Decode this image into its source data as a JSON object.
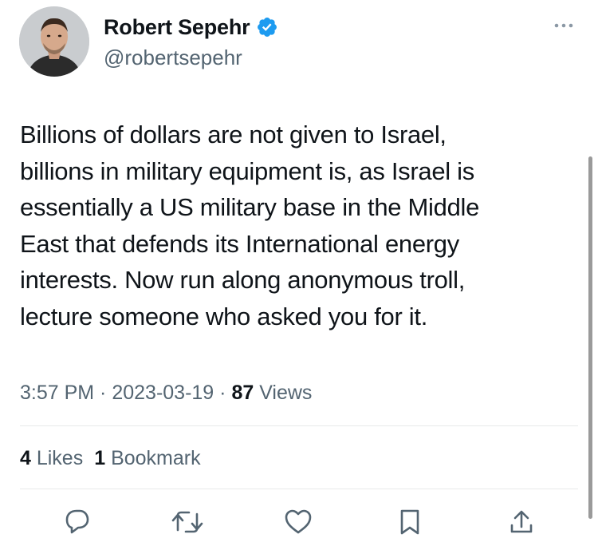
{
  "author": {
    "display_name": "Robert Sepehr",
    "handle": "@robertsepehr",
    "verified": true
  },
  "tweet": {
    "text": "Billions of dollars are not given to Israel,\nbillions in military equipment is, as Israel is\nessentially a US military base in the Middle\nEast that defends its International energy\ninterests. Now run along anonymous troll,\nlecture someone who asked you for it."
  },
  "meta": {
    "time": "3:57 PM",
    "separator": " · ",
    "date": "2023-03-19",
    "views_count": "87",
    "views_label": " Views"
  },
  "stats": {
    "likes_count": "4",
    "likes_label": " Likes",
    "bookmarks_count": "1",
    "bookmarks_label": " Bookmark"
  },
  "icons": {
    "more": "more-icon",
    "verified": "verified-badge-icon",
    "reply": "reply-icon",
    "retweet": "retweet-icon",
    "like": "like-icon",
    "bookmark": "bookmark-icon",
    "share": "share-icon"
  },
  "colors": {
    "verified_blue": "#1d9bf0",
    "secondary_text": "#536471",
    "primary_text": "#0f1419",
    "divider": "#e7e9ea"
  }
}
